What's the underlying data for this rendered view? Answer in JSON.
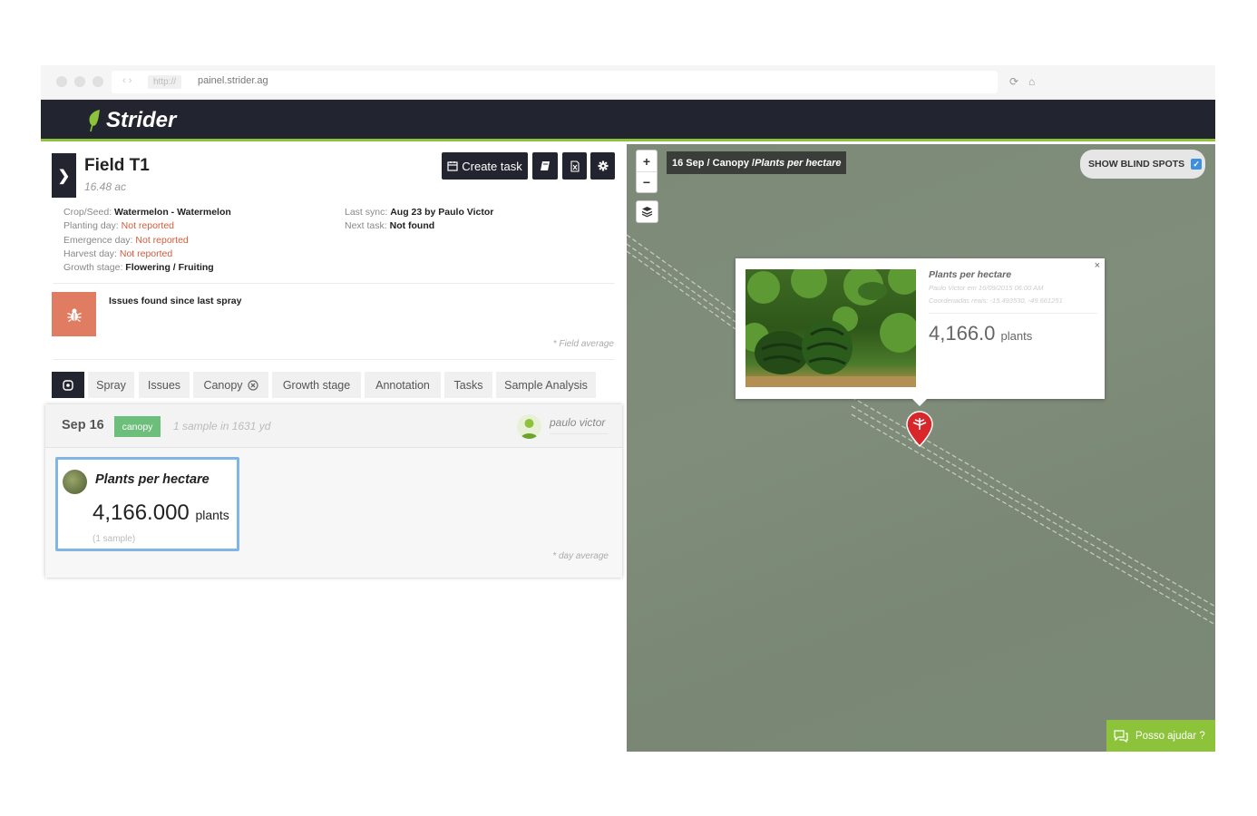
{
  "browser": {
    "url_protocol": "http://",
    "url": "painel.strider.ag"
  },
  "app": {
    "brand": "Strider"
  },
  "field": {
    "name": "Field T1",
    "area": "16.48 ac"
  },
  "toolbar": {
    "create_task_label": "Create task"
  },
  "details_left": [
    {
      "label": "Crop/Seed: ",
      "value": "Watermelon - Watermelon",
      "status": "normal"
    },
    {
      "label": "Planting day: ",
      "value": "Not reported",
      "status": "missing"
    },
    {
      "label": "Emergence day: ",
      "value": "Not reported",
      "status": "missing"
    },
    {
      "label": "Harvest day: ",
      "value": "Not reported",
      "status": "missing"
    },
    {
      "label": "Growth stage: ",
      "value": "Flowering / Fruiting",
      "status": "normal"
    }
  ],
  "details_right": [
    {
      "label": "Last sync: ",
      "value": "Aug 23 by Paulo Victor"
    },
    {
      "label": "Next task: ",
      "value": "Not found"
    }
  ],
  "issues": {
    "text": "Issues found since last spray",
    "note": "* Field average",
    "color": "#df7c62"
  },
  "tabs": [
    {
      "label": "Spray"
    },
    {
      "label": "Issues"
    },
    {
      "label": "Canopy"
    },
    {
      "label": "Growth stage"
    },
    {
      "label": "Annotation"
    },
    {
      "label": "Tasks"
    },
    {
      "label": "Sample Analysis"
    }
  ],
  "sample_card": {
    "date": "Sep 16",
    "badge": "canopy",
    "sample_info": "1 sample in 1631 yd",
    "user": "paulo victor",
    "metric_title": "Plants per hectare",
    "metric_value": "4,166.000",
    "metric_unit": "plants",
    "metric_count": "(1 sample)",
    "note": "* day average"
  },
  "map": {
    "label_prefix": "16 Sep / Canopy / ",
    "label_metric": "Plants per hectare",
    "blind_spots_label": "SHOW BLIND SPOTS",
    "blind_spots_checked": true
  },
  "popup": {
    "title": "Plants per hectare",
    "author_line": "Paulo Victor em 16/09/2015 06:00 AM",
    "coords_line": "Coordenadas reais: -15.493530, -49.661251",
    "value": "4,166.0",
    "unit": "plants"
  },
  "help": {
    "label": "Posso ajudar ?"
  },
  "colors": {
    "dark": "#22252f",
    "accent": "#8dc33b",
    "missing": "#d35b3c",
    "badge": "#6cbf7a"
  }
}
